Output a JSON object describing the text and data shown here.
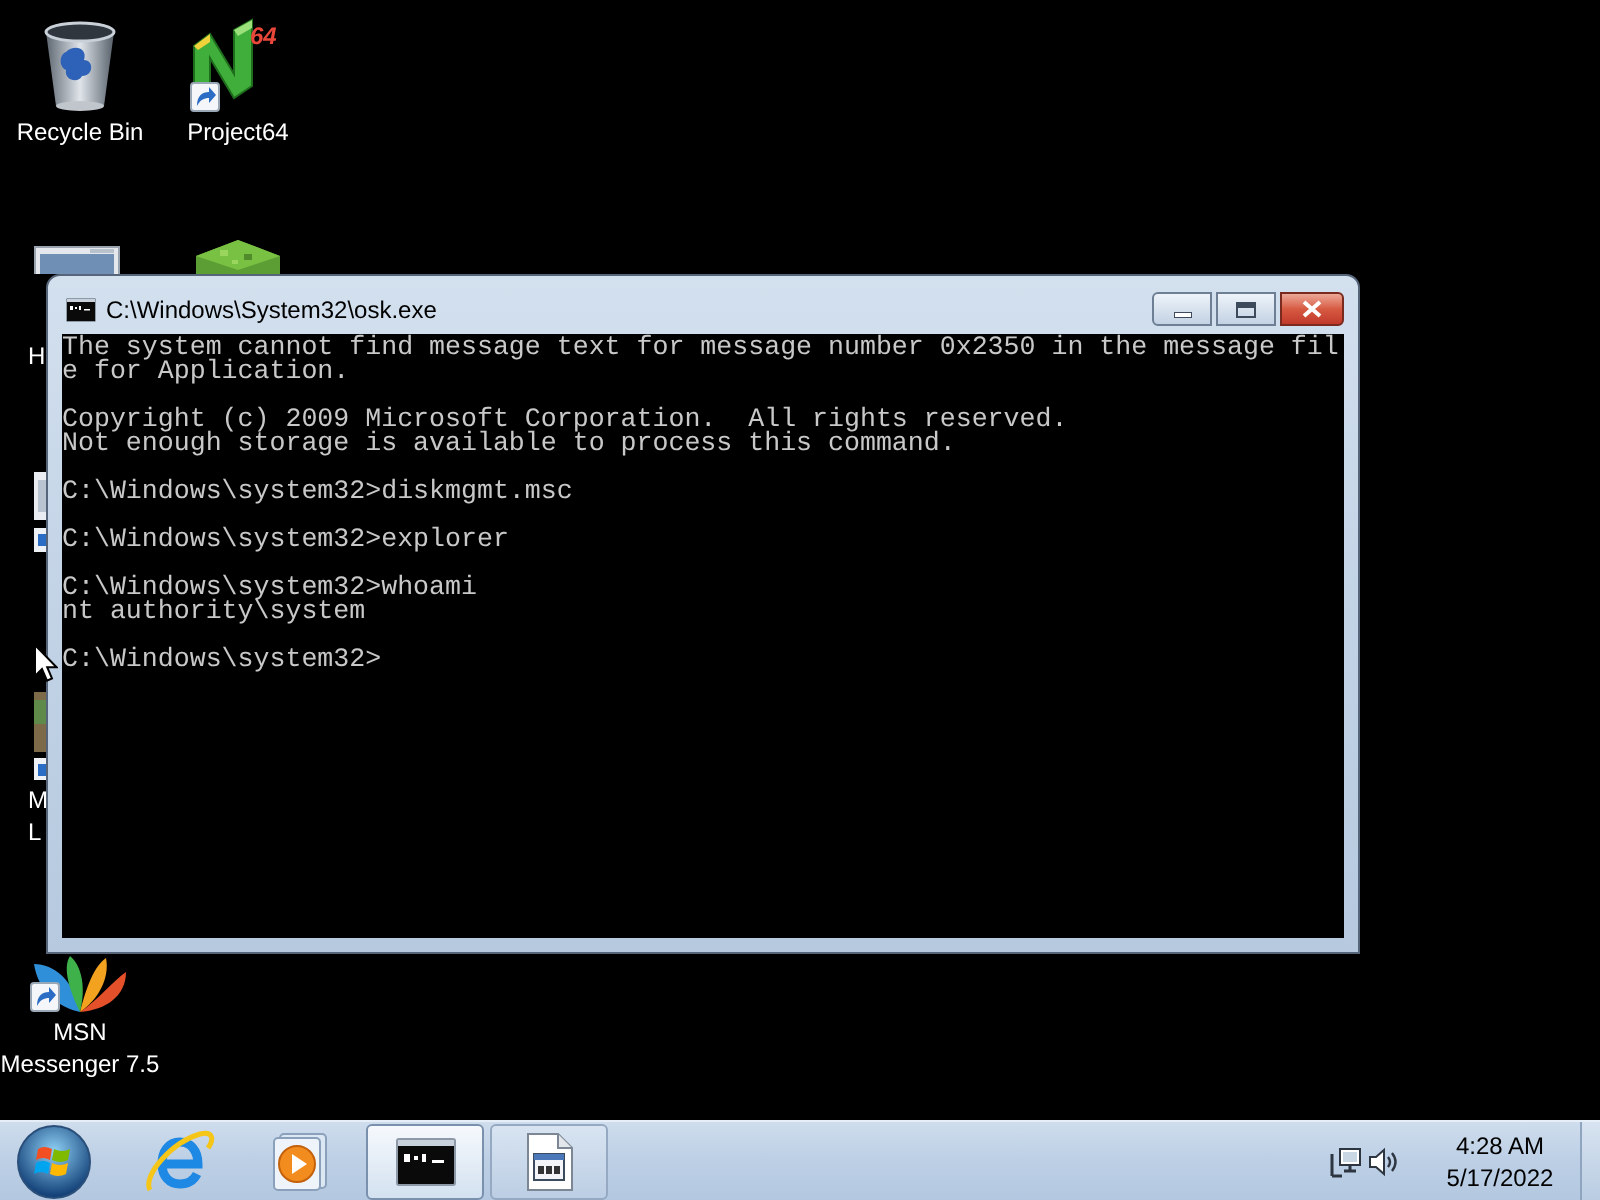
{
  "desktop_icons": [
    {
      "lines": [
        "Recycle Bin"
      ],
      "shortcut": false
    },
    {
      "lines": [
        "Project64"
      ],
      "shortcut": true,
      "badge": "64"
    },
    {
      "lines": [
        "H"
      ]
    },
    {
      "lines": [
        "M",
        "L"
      ]
    },
    {
      "lines": [
        "MSN",
        "Messenger 7.5"
      ],
      "shortcut": true
    }
  ],
  "console_window": {
    "title": "C:\\Windows\\System32\\osk.exe",
    "blocks": [
      [
        "The system cannot find message text for message number 0x2350 in the message fil",
        "e for Application."
      ],
      [
        "Copyright (c) 2009 Microsoft Corporation.  All rights reserved.",
        "Not enough storage is available to process this command."
      ],
      [
        "C:\\Windows\\system32>diskmgmt.msc"
      ],
      [
        "C:\\Windows\\system32>explorer"
      ],
      [
        "C:\\Windows\\system32>whoami",
        "nt authority\\system"
      ],
      [
        "C:\\Windows\\system32>"
      ]
    ]
  },
  "taskbar": {
    "open_windows": [
      {
        "selected": true
      },
      {
        "selected": false
      }
    ],
    "clock": {
      "time": "4:28 AM",
      "date": "5/17/2022"
    }
  }
}
